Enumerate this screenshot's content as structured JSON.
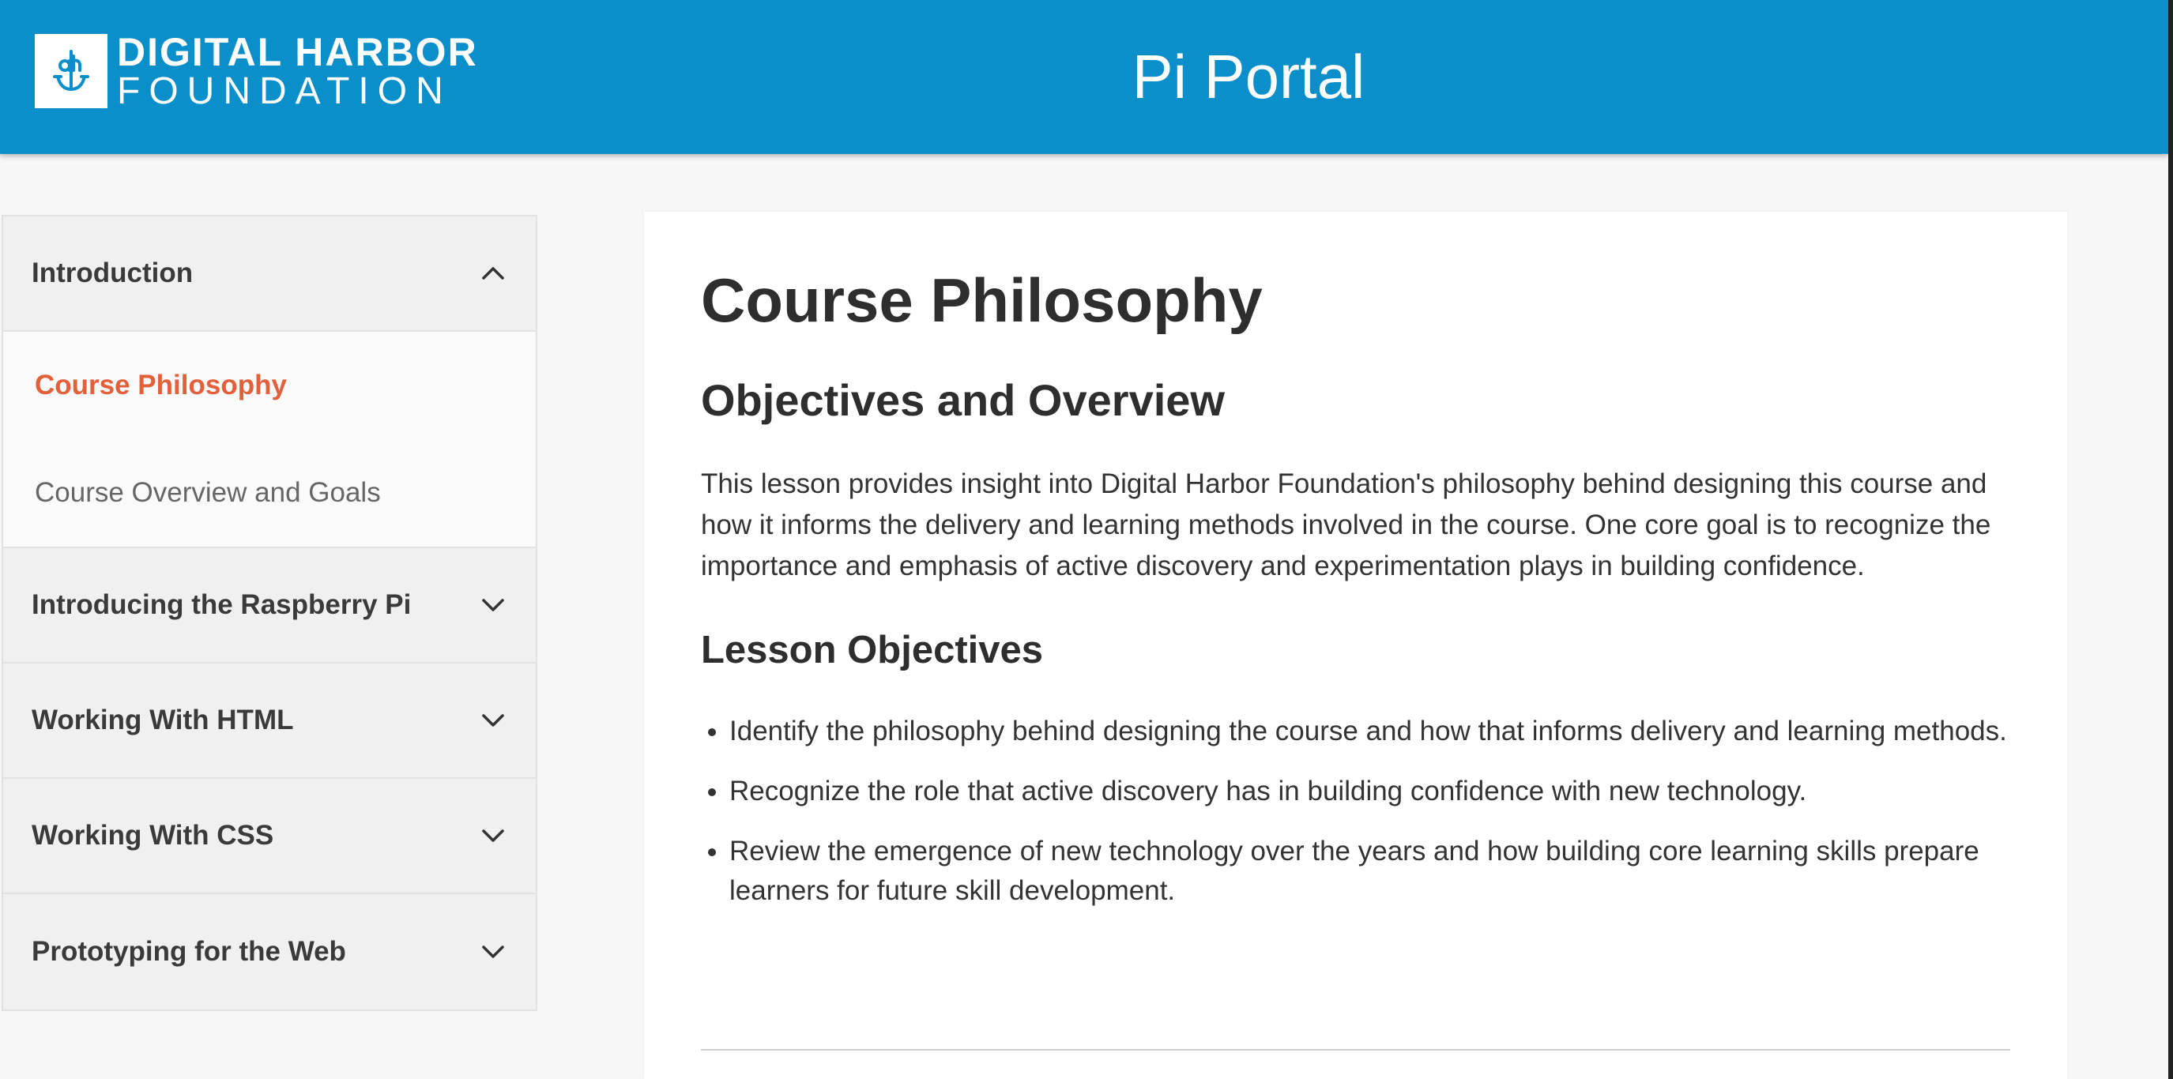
{
  "header": {
    "logo_line1": "DIGITAL HARBOR",
    "logo_line2": "FOUNDATION",
    "site_title": "Pi Portal",
    "background": "#0b8fca"
  },
  "sidebar": {
    "sections": [
      {
        "title": "Introduction",
        "expanded": true,
        "items": [
          {
            "label": "Course Philosophy",
            "active": true
          },
          {
            "label": "Course Overview and Goals",
            "active": false
          }
        ]
      },
      {
        "title": "Introducing the Raspberry Pi",
        "expanded": false
      },
      {
        "title": "Working With HTML",
        "expanded": false
      },
      {
        "title": "Working With CSS",
        "expanded": false
      },
      {
        "title": "Prototyping for the Web",
        "expanded": false
      }
    ],
    "active_color": "#e2603a",
    "icons": {
      "expanded": "chevron-up-icon",
      "collapsed": "chevron-down-icon"
    }
  },
  "content": {
    "title": "Course Philosophy",
    "subtitle": "Objectives and Overview",
    "intro": "This lesson provides insight into Digital Harbor Foundation's philosophy behind designing this course and how it informs the delivery and learning methods involved in the course. One core goal is to recognize the importance and emphasis of active discovery and experimentation plays in building confidence.",
    "objectives_heading": "Lesson Objectives",
    "objectives": [
      "Identify the philosophy behind designing the course and how that informs delivery and learning methods.",
      "Recognize the role that active discovery has in building confidence with new technology.",
      "Review the emergence of new technology over the years and how building core learning skills prepare learners for future skill development."
    ]
  }
}
